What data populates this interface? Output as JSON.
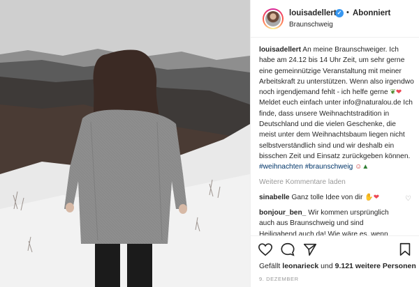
{
  "header": {
    "username": "louisadellert",
    "verified_icon": "verified-badge-icon",
    "separator": "•",
    "follow_label": "Abonniert",
    "location": "Braunschweig"
  },
  "caption": {
    "username": "louisadellert",
    "text_1": "An meine Braunschweiger. Ich habe am 24.12 bis 14 Uhr Zeit, um sehr gerne eine gemeinnützige Veranstaltung mit meiner Arbeitskraft zu unterstützen. Wenn also irgendwo noch irgendjemand fehlt - ich helfe gerne ",
    "text_2": " Meldet euch einfach unter info@naturalou.de Ich finde, dass unsere Weihnachtstradition in Deutschland und die vielen Geschenke, die meist unter dem Weihnachtsbaum liegen nicht selbstverständlich sind und wir deshalb ein bisschen Zeit und Einsatz zurückgeben können. ",
    "hashtag_1": "#weihnachten",
    "hashtag_2": "#braunschweig"
  },
  "load_more": "Weitere Kommentare laden",
  "comments": [
    {
      "username": "sinabelle",
      "text": "Ganz tolle Idee von dir"
    },
    {
      "username": "bonjour_ben_",
      "text": "Wir kommen ursprünglich auch aus Braunschweig und sind Heiligabend auch da! Wie wäre es, wenn wir entweder"
    }
  ],
  "likes": {
    "prefix": "Gefällt",
    "user": "leonarieck",
    "middle": "und",
    "count": "9.121 weitere Personen"
  },
  "date": "9. DEZEMBER",
  "colors": {
    "accent": "#3897f0",
    "link": "#003569",
    "heart": "#ed4956",
    "muted": "#999999"
  }
}
